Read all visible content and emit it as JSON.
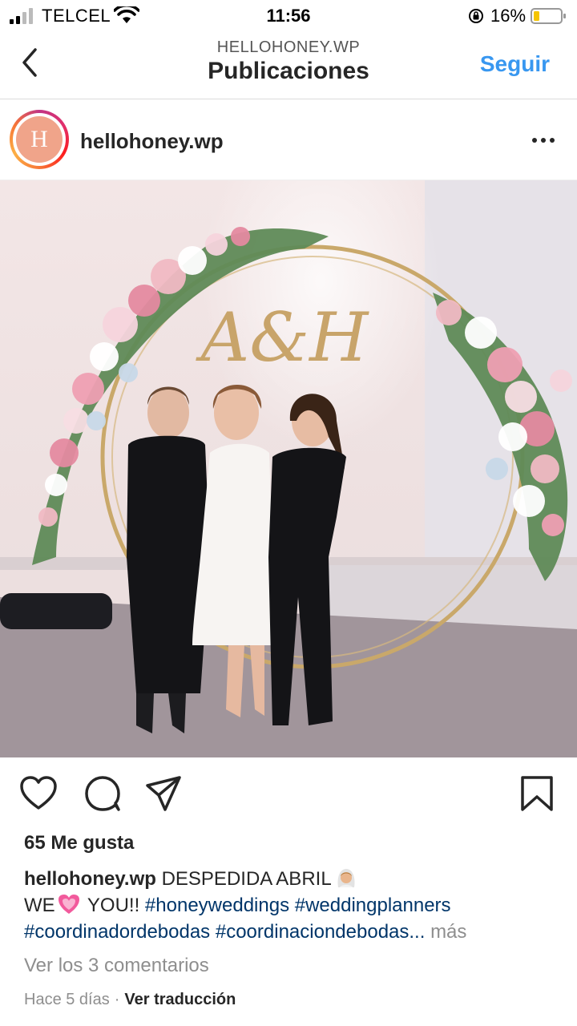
{
  "status_bar": {
    "carrier": "TELCEL",
    "time": "11:56",
    "battery": "16%"
  },
  "nav": {
    "subtitle": "HELLOHONEY.WP",
    "title": "Publicaciones",
    "follow_label": "Seguir"
  },
  "post": {
    "username": "hellohoney.wp",
    "avatar_letter": "H",
    "photo_monogram": "A&H",
    "likes": "65 Me gusta",
    "caption": {
      "user": "hellohoney.wp",
      "text1": " DESPEDIDA ABRIL",
      "text2": "WE",
      "text3": " YOU!! ",
      "tag1": "#honeyweddings",
      "tag2": "#weddingplanners",
      "tag3": "#coordinadordebodas",
      "tag4": "#coordinaciondebodas...",
      "more": "más"
    },
    "view_comments": "Ver los 3 comentarios",
    "time_ago": "Hace 5 días",
    "separator": "·",
    "translate": "Ver traducción"
  },
  "icons": [
    "back-icon",
    "more-icon",
    "heart-icon",
    "comment-icon",
    "share-icon",
    "bookmark-icon"
  ],
  "colors": {
    "link_blue": "#3897f0",
    "hashtag": "#003569",
    "muted": "#8e8e8e",
    "text": "#262626"
  }
}
